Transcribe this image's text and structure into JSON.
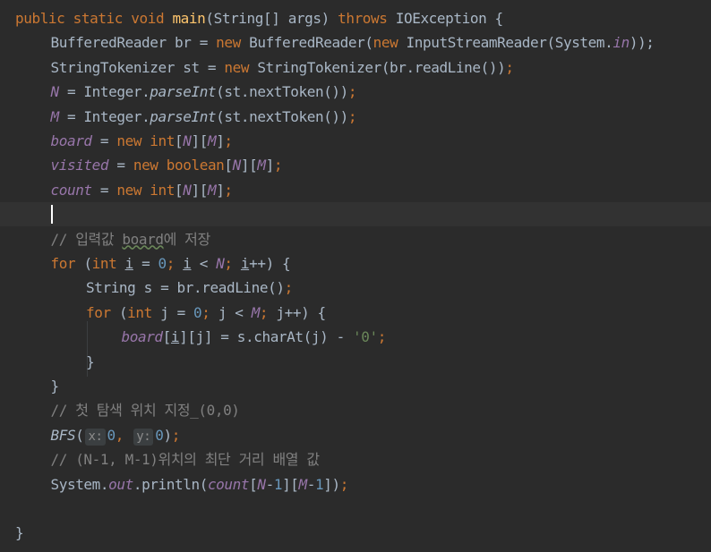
{
  "editor": {
    "lines": [
      {
        "indent": 0,
        "tokens": [
          {
            "t": "public static void ",
            "c": "kw"
          },
          {
            "t": "main",
            "c": "fn"
          },
          {
            "t": "(String[] args) ",
            "c": ""
          },
          {
            "t": "throws ",
            "c": "kw"
          },
          {
            "t": "IOException {",
            "c": ""
          }
        ]
      },
      {
        "indent": 1,
        "tokens": [
          {
            "t": "BufferedReader br = ",
            "c": ""
          },
          {
            "t": "new ",
            "c": "kw"
          },
          {
            "t": "BufferedReader(",
            "c": ""
          },
          {
            "t": "new ",
            "c": "kw"
          },
          {
            "t": "InputStreamReader(System.",
            "c": ""
          },
          {
            "t": "in",
            "c": "field"
          },
          {
            "t": "));",
            "c": ""
          }
        ]
      },
      {
        "indent": 1,
        "tokens": [
          {
            "t": "StringTokenizer st = ",
            "c": ""
          },
          {
            "t": "new ",
            "c": "kw"
          },
          {
            "t": "StringTokenizer(br.readLine())",
            "c": ""
          },
          {
            "t": ";",
            "c": "kw"
          }
        ]
      },
      {
        "indent": 1,
        "tokens": [
          {
            "t": "N",
            "c": "field"
          },
          {
            "t": " = Integer.",
            "c": ""
          },
          {
            "t": "parseInt",
            "c": "static-m"
          },
          {
            "t": "(st.nextToken())",
            "c": ""
          },
          {
            "t": ";",
            "c": "kw"
          }
        ]
      },
      {
        "indent": 1,
        "tokens": [
          {
            "t": "M",
            "c": "field"
          },
          {
            "t": " = Integer.",
            "c": ""
          },
          {
            "t": "parseInt",
            "c": "static-m"
          },
          {
            "t": "(st.nextToken())",
            "c": ""
          },
          {
            "t": ";",
            "c": "kw"
          }
        ]
      },
      {
        "indent": 1,
        "tokens": [
          {
            "t": "board",
            "c": "field"
          },
          {
            "t": " = ",
            "c": ""
          },
          {
            "t": "new int",
            "c": "kw"
          },
          {
            "t": "[",
            "c": ""
          },
          {
            "t": "N",
            "c": "field"
          },
          {
            "t": "][",
            "c": ""
          },
          {
            "t": "M",
            "c": "field"
          },
          {
            "t": "]",
            "c": ""
          },
          {
            "t": ";",
            "c": "kw"
          }
        ]
      },
      {
        "indent": 1,
        "tokens": [
          {
            "t": "visited",
            "c": "field"
          },
          {
            "t": " = ",
            "c": ""
          },
          {
            "t": "new boolean",
            "c": "kw"
          },
          {
            "t": "[",
            "c": ""
          },
          {
            "t": "N",
            "c": "field"
          },
          {
            "t": "][",
            "c": ""
          },
          {
            "t": "M",
            "c": "field"
          },
          {
            "t": "]",
            "c": ""
          },
          {
            "t": ";",
            "c": "kw"
          }
        ]
      },
      {
        "indent": 1,
        "tokens": [
          {
            "t": "count",
            "c": "field"
          },
          {
            "t": " = ",
            "c": ""
          },
          {
            "t": "new int",
            "c": "kw"
          },
          {
            "t": "[",
            "c": ""
          },
          {
            "t": "N",
            "c": "field"
          },
          {
            "t": "][",
            "c": ""
          },
          {
            "t": "M",
            "c": "field"
          },
          {
            "t": "]",
            "c": ""
          },
          {
            "t": ";",
            "c": "kw"
          }
        ]
      },
      {
        "indent": 1,
        "current": true,
        "tokens": []
      },
      {
        "indent": 1,
        "tokens": [
          {
            "t": "// 입력값 ",
            "c": "comment"
          },
          {
            "t": "board",
            "c": "comment typo"
          },
          {
            "t": "에 저장",
            "c": "comment"
          }
        ]
      },
      {
        "indent": 1,
        "tokens": [
          {
            "t": "for ",
            "c": "kw"
          },
          {
            "t": "(",
            "c": ""
          },
          {
            "t": "int ",
            "c": "kw"
          },
          {
            "t": "i",
            "c": "ul"
          },
          {
            "t": " = ",
            "c": ""
          },
          {
            "t": "0",
            "c": "num"
          },
          {
            "t": "; ",
            "c": "kw"
          },
          {
            "t": "i",
            "c": "ul"
          },
          {
            "t": " < ",
            "c": ""
          },
          {
            "t": "N",
            "c": "field"
          },
          {
            "t": "; ",
            "c": "kw"
          },
          {
            "t": "i",
            "c": "ul"
          },
          {
            "t": "++) {",
            "c": ""
          }
        ]
      },
      {
        "indent": 2,
        "tokens": [
          {
            "t": "String s = br.readLine()",
            "c": ""
          },
          {
            "t": ";",
            "c": "kw"
          }
        ]
      },
      {
        "indent": 2,
        "tokens": [
          {
            "t": "for ",
            "c": "kw"
          },
          {
            "t": "(",
            "c": ""
          },
          {
            "t": "int ",
            "c": "kw"
          },
          {
            "t": "j = ",
            "c": ""
          },
          {
            "t": "0",
            "c": "num"
          },
          {
            "t": "; ",
            "c": "kw"
          },
          {
            "t": "j < ",
            "c": ""
          },
          {
            "t": "M",
            "c": "field"
          },
          {
            "t": "; ",
            "c": "kw"
          },
          {
            "t": "j++) {",
            "c": ""
          }
        ]
      },
      {
        "indent": 3,
        "tokens": [
          {
            "t": "board",
            "c": "field"
          },
          {
            "t": "[",
            "c": ""
          },
          {
            "t": "i",
            "c": "ul"
          },
          {
            "t": "][j] = s.charAt(j) - ",
            "c": ""
          },
          {
            "t": "'0'",
            "c": "str"
          },
          {
            "t": ";",
            "c": "kw"
          }
        ]
      },
      {
        "indent": 2,
        "tokens": [
          {
            "t": "}",
            "c": ""
          }
        ]
      },
      {
        "indent": 1,
        "tokens": [
          {
            "t": "}",
            "c": ""
          }
        ]
      },
      {
        "indent": 1,
        "tokens": [
          {
            "t": "// 첫 탐색 위치 지정_(0,0)",
            "c": "comment"
          }
        ]
      },
      {
        "indent": 1,
        "tokens": [
          {
            "t": "BFS",
            "c": "static-m"
          },
          {
            "t": "(",
            "c": ""
          },
          {
            "t": "x:",
            "c": "hint"
          },
          {
            "t": "0",
            "c": "num"
          },
          {
            "t": ", ",
            "c": "kw"
          },
          {
            "t": "y:",
            "c": "hint"
          },
          {
            "t": "0",
            "c": "num"
          },
          {
            "t": ")",
            "c": ""
          },
          {
            "t": ";",
            "c": "kw"
          }
        ]
      },
      {
        "indent": 1,
        "tokens": [
          {
            "t": "// (N-1, M-1)위치의 최단 거리 배열 값",
            "c": "comment"
          }
        ]
      },
      {
        "indent": 1,
        "tokens": [
          {
            "t": "System.",
            "c": ""
          },
          {
            "t": "out",
            "c": "field"
          },
          {
            "t": ".println(",
            "c": ""
          },
          {
            "t": "count",
            "c": "field"
          },
          {
            "t": "[",
            "c": ""
          },
          {
            "t": "N",
            "c": "field"
          },
          {
            "t": "-",
            "c": ""
          },
          {
            "t": "1",
            "c": "num"
          },
          {
            "t": "][",
            "c": ""
          },
          {
            "t": "M",
            "c": "field"
          },
          {
            "t": "-",
            "c": ""
          },
          {
            "t": "1",
            "c": "num"
          },
          {
            "t": "])",
            "c": ""
          },
          {
            "t": ";",
            "c": "kw"
          }
        ]
      },
      {
        "indent": 0,
        "tokens": []
      },
      {
        "indent": 0,
        "tokens": [
          {
            "t": "}",
            "c": ""
          }
        ]
      }
    ]
  }
}
